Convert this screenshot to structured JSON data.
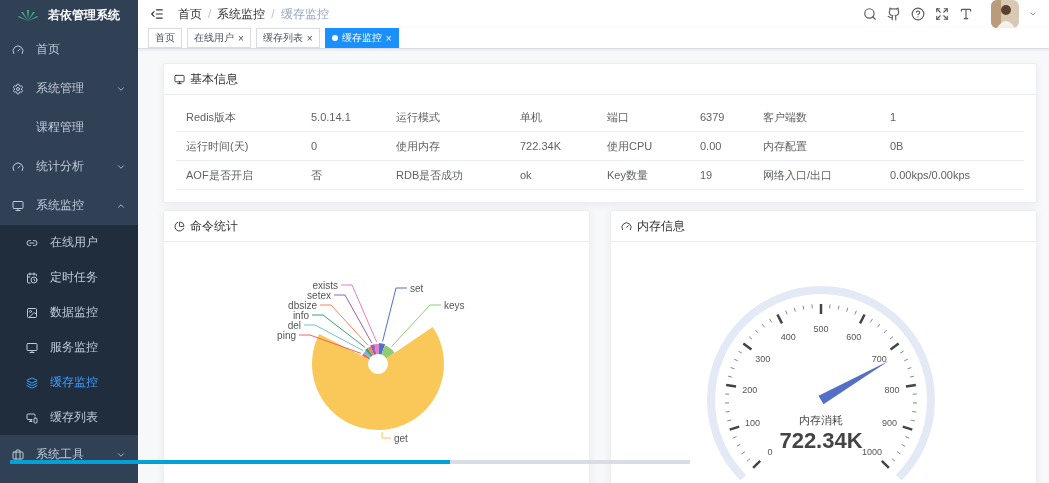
{
  "sidebar": {
    "logo_title": "若依管理系统",
    "items": [
      {
        "label": "首页",
        "selected": false
      },
      {
        "label": "系统管理",
        "selected": false,
        "expanded": false
      },
      {
        "label": "课程管理",
        "selected": false
      },
      {
        "label": "统计分析",
        "selected": false,
        "expanded": false
      },
      {
        "label": "系统监控",
        "selected": false,
        "expanded": true,
        "children": [
          {
            "label": "在线用户",
            "selected": false
          },
          {
            "label": "定时任务",
            "selected": false
          },
          {
            "label": "数据监控",
            "selected": false
          },
          {
            "label": "服务监控",
            "selected": false
          },
          {
            "label": "缓存监控",
            "selected": true
          },
          {
            "label": "缓存列表",
            "selected": false
          }
        ]
      },
      {
        "label": "系统工具",
        "selected": false,
        "expanded": false
      }
    ]
  },
  "breadcrumb": [
    "首页",
    "系统监控",
    "缓存监控"
  ],
  "breadcrumb_separator": "/",
  "tabs": [
    {
      "label": "首页",
      "selected": false,
      "closable": false
    },
    {
      "label": "在线用户",
      "selected": false,
      "closable": true
    },
    {
      "label": "缓存列表",
      "selected": false,
      "closable": true
    },
    {
      "label": "缓存监控",
      "selected": true,
      "closable": true
    }
  ],
  "close_glyph": "×",
  "basic_info": {
    "title": "基本信息",
    "rows": [
      [
        "Redis版本",
        "5.0.14.1",
        "运行模式",
        "单机",
        "端口",
        "6379",
        "客户端数",
        "1"
      ],
      [
        "运行时间(天)",
        "0",
        "使用内存",
        "722.34K",
        "使用CPU",
        "0.00",
        "内存配置",
        "0B"
      ],
      [
        "AOF是否开启",
        "否",
        "RDB是否成功",
        "ok",
        "Key数量",
        "19",
        "网络入口/出口",
        "0.00kps/0.00kps"
      ]
    ]
  },
  "command_stats": {
    "title": "命令统计",
    "slices": [
      {
        "label": "ping",
        "color": "#ee6666"
      },
      {
        "label": "del",
        "color": "#73c0de"
      },
      {
        "label": "info",
        "color": "#3ba272"
      },
      {
        "label": "dbsize",
        "color": "#fc8452"
      },
      {
        "label": "setex",
        "color": "#9a60b4"
      },
      {
        "label": "exists",
        "color": "#ea7ccc"
      },
      {
        "label": "set",
        "color": "#5470c6"
      },
      {
        "label": "keys",
        "color": "#91cc75"
      },
      {
        "label": "get",
        "color": "#fac858"
      }
    ]
  },
  "memory_info": {
    "title": "内存信息",
    "gauge": {
      "tick_labels": [
        "0",
        "100",
        "200",
        "300",
        "400",
        "500",
        "600",
        "700",
        "800",
        "900",
        "1000"
      ],
      "caption": "内存消耗",
      "reading": "722.34K",
      "level": 0.72234
    }
  },
  "video_progress": {
    "level": 0.647
  }
}
